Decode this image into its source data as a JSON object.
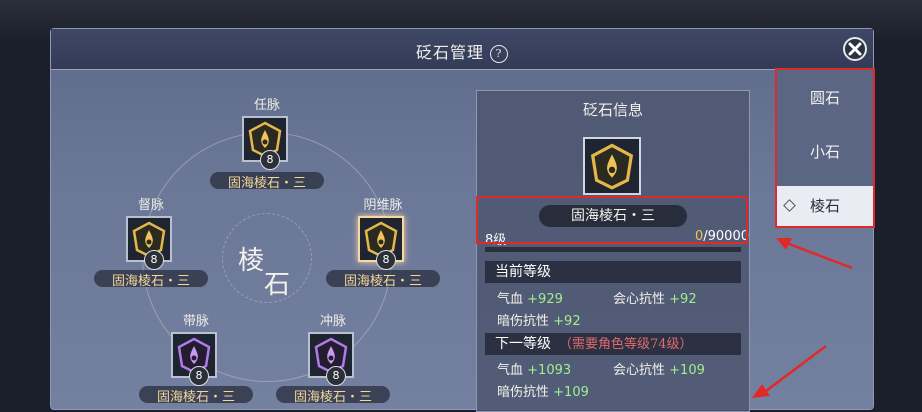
{
  "window": {
    "title": "砭石管理",
    "help": "?"
  },
  "center": {
    "char1": "棱",
    "char2": "石"
  },
  "slots": [
    {
      "meridian": "任脉",
      "level": "8",
      "gem": "固海棱石・三",
      "tier": "gold"
    },
    {
      "meridian": "督脉",
      "level": "8",
      "gem": "固海棱石・三",
      "tier": "gold"
    },
    {
      "meridian": "阴维脉",
      "level": "8",
      "gem": "固海棱石・三",
      "tier": "gold",
      "selected": true
    },
    {
      "meridian": "带脉",
      "level": "8",
      "gem": "固海棱石・三",
      "tier": "purple"
    },
    {
      "meridian": "冲脉",
      "level": "8",
      "gem": "固海棱石・三",
      "tier": "purple"
    }
  ],
  "info": {
    "title": "砭石信息",
    "gem_name": "固海棱石・三",
    "level_text": "8级",
    "exp_current": "0",
    "exp_total": "/90000",
    "exp_fraction": 0.0,
    "current": {
      "header": "当前等级",
      "stats": [
        {
          "label": "气血",
          "value": "+929"
        },
        {
          "label": "会心抗性",
          "value": "+92"
        },
        {
          "label": "暗伤抗性",
          "value": "+92"
        }
      ]
    },
    "next": {
      "header": "下一等级",
      "requirement": "（需要角色等级74级）",
      "stats": [
        {
          "label": "气血",
          "value": "+1093"
        },
        {
          "label": "会心抗性",
          "value": "+109"
        },
        {
          "label": "暗伤抗性",
          "value": "+109"
        }
      ]
    }
  },
  "sidebar": {
    "items": [
      "圆石",
      "小石",
      "棱石"
    ],
    "active": 2
  },
  "colors": {
    "highlight": "#e02a2a",
    "gold": "#f0c35a",
    "stat_value": "#9ff08f"
  }
}
